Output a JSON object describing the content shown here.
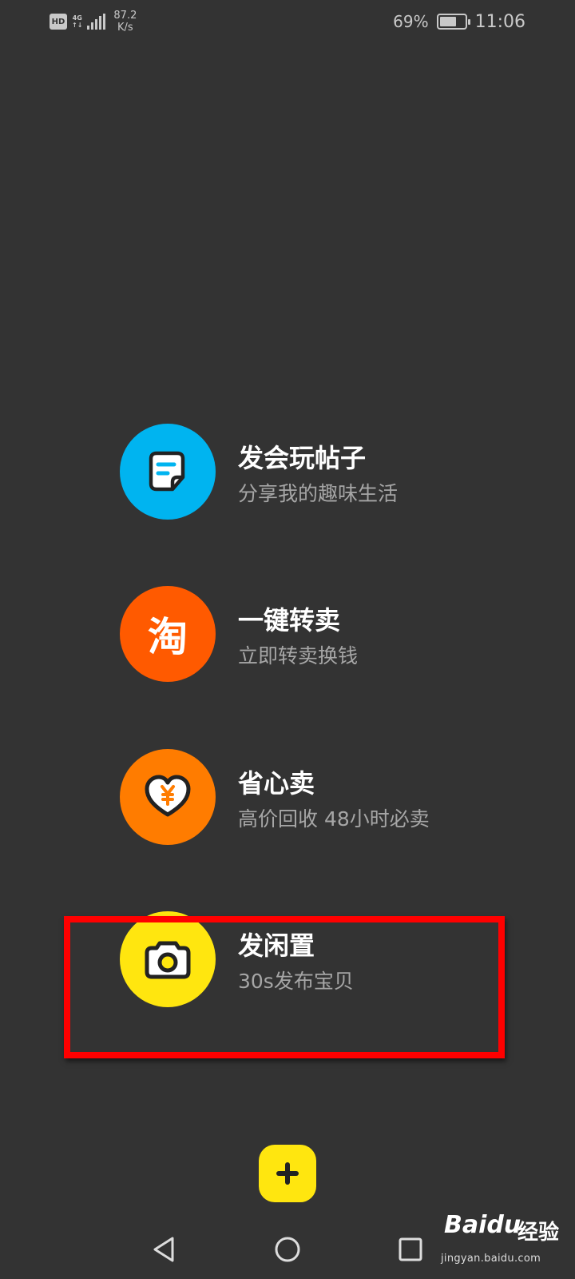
{
  "status_bar": {
    "hd": "HD",
    "network_type": "4G",
    "network_sub": "↑↓",
    "speed_value": "87.2",
    "speed_unit": "K/s",
    "battery_percent": "69%",
    "battery_level": 0.69,
    "time": "11:06"
  },
  "menu": {
    "items": [
      {
        "title": "发会玩帖子",
        "subtitle": "分享我的趣味生活",
        "icon": "note-icon",
        "color": "#00b4f0"
      },
      {
        "title": "一键转卖",
        "subtitle": "立即转卖换钱",
        "icon": "taobao-icon",
        "glyph": "淘",
        "color": "#ff5a00"
      },
      {
        "title": "省心卖",
        "subtitle": "高价回收 48小时必卖",
        "icon": "heart-yuan-icon",
        "color": "#ff7c00"
      },
      {
        "title": "发闲置",
        "subtitle": "30s发布宝贝",
        "icon": "camera-icon",
        "color": "#ffe60f"
      }
    ]
  },
  "fab": {
    "icon": "plus-icon",
    "color": "#ffe60f"
  },
  "nav_bar": {
    "back": "back-triangle-icon",
    "home": "home-circle-icon",
    "recents": "recents-square-icon"
  },
  "watermark": {
    "brand": "Baidu",
    "suffix": "经验",
    "url": "jingyan.baidu.com"
  },
  "colors": {
    "background": "#333333",
    "highlight": "#ff0000"
  }
}
